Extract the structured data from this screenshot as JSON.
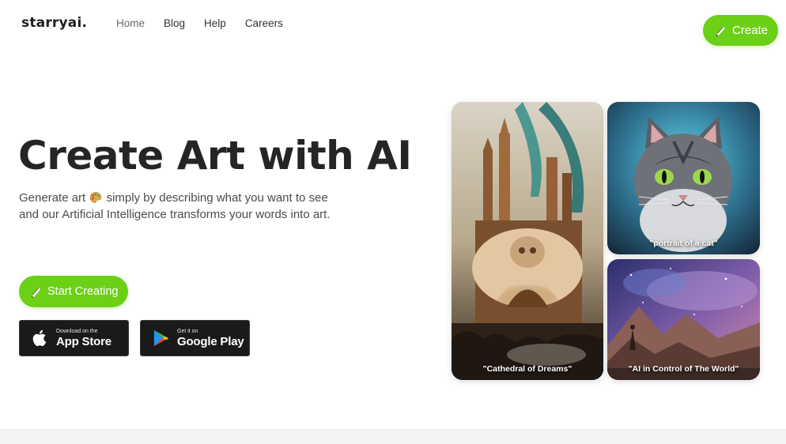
{
  "brand": {
    "logo": "starryai."
  },
  "nav": {
    "items": [
      {
        "label": "Home"
      },
      {
        "label": "Blog"
      },
      {
        "label": "Help"
      },
      {
        "label": "Careers"
      }
    ],
    "create_label": "Create"
  },
  "hero": {
    "title": "Create Art with AI",
    "subtitle_part1": "Generate art",
    "subtitle_part2": "simply by describing what you want to see",
    "subtitle_line2": "and our Artificial Intelligence transforms your words into art.",
    "start_label": "Start Creating"
  },
  "stores": {
    "apple": {
      "small": "Download on the",
      "big": "App Store",
      "icon": "apple-icon"
    },
    "google": {
      "small": "Get it on",
      "big": "Google Play",
      "icon": "google-play-icon"
    }
  },
  "gallery": {
    "cathedral_caption": "\"Cathedral of Dreams\"",
    "cat_caption": "\"portrait of a cat\"",
    "ai_caption": "\"AI in Control of The World\""
  },
  "colors": {
    "accent": "#6cd016",
    "text": "#252525",
    "store_bg": "#1a1a1a"
  }
}
